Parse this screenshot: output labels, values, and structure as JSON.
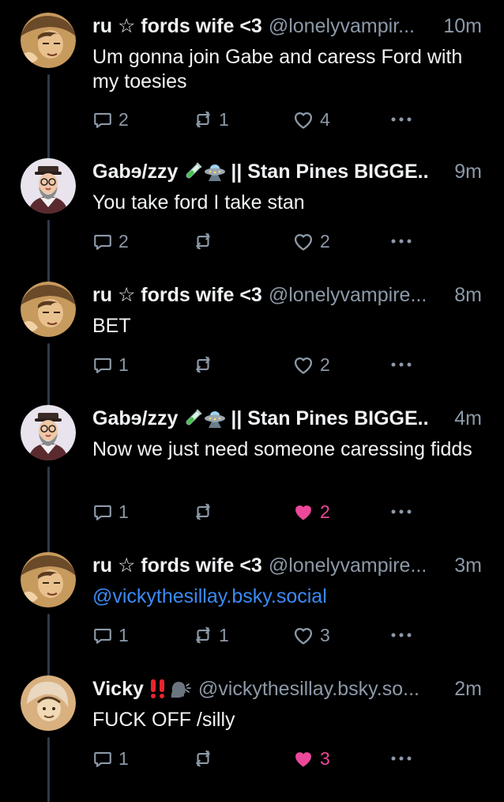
{
  "posts": [
    {
      "name": "ru ☆ fords wife <3",
      "name_suffix": "",
      "handle": "@lonelyvampir...",
      "time": "10m",
      "text": "Um gonna join Gabe and caress Ford with my toesies",
      "text_is_link": false,
      "replies": "2",
      "reposts": "1",
      "likes": "4",
      "liked": false,
      "emoji": [],
      "avatar": "ru"
    },
    {
      "name": "Gabɘ/zzy",
      "name_suffix": "|| Stan Pines BIGGE..",
      "handle": "",
      "time": "9m",
      "text": "You take ford I take stan",
      "text_is_link": false,
      "replies": "2",
      "reposts": "",
      "likes": "2",
      "liked": false,
      "emoji": [
        "test-tube-icon",
        "flying-saucer-icon"
      ],
      "avatar": "gabe"
    },
    {
      "name": "ru ☆ fords wife <3",
      "name_suffix": "",
      "handle": "@lonelyvampire...",
      "time": "8m",
      "text": "BET",
      "text_is_link": false,
      "replies": "1",
      "reposts": "",
      "likes": "2",
      "liked": false,
      "emoji": [],
      "avatar": "ru"
    },
    {
      "name": "Gabɘ/zzy",
      "name_suffix": "|| Stan Pines BIGGE..",
      "handle": "",
      "time": "4m",
      "text": "Now we just need someone caressing fidds",
      "text_is_link": false,
      "replies": "1",
      "reposts": "",
      "likes": "2",
      "liked": true,
      "emoji": [
        "test-tube-icon",
        "flying-saucer-icon"
      ],
      "avatar": "gabe"
    },
    {
      "name": "ru ☆ fords wife <3",
      "name_suffix": "",
      "handle": "@lonelyvampire...",
      "time": "3m",
      "text": "@vickythesillay.bsky.social",
      "text_is_link": true,
      "replies": "1",
      "reposts": "1",
      "likes": "3",
      "liked": false,
      "emoji": [],
      "avatar": "ru"
    },
    {
      "name": "Vicky",
      "name_suffix": "",
      "handle": "@vickythesillay.bsky.so...",
      "time": "2m",
      "text": "FUCK OFF /silly",
      "text_is_link": false,
      "replies": "1",
      "reposts": "",
      "likes": "3",
      "liked": true,
      "emoji": [
        "double-exclamation-icon",
        "speaking-head-icon"
      ],
      "avatar": "vicky"
    }
  ],
  "colors": {
    "background": "#000000",
    "text": "#f1f3f5",
    "muted": "#8c99a8",
    "link": "#3b8bf5",
    "like_active": "#ec4899",
    "thread_line": "#2e3a48"
  }
}
